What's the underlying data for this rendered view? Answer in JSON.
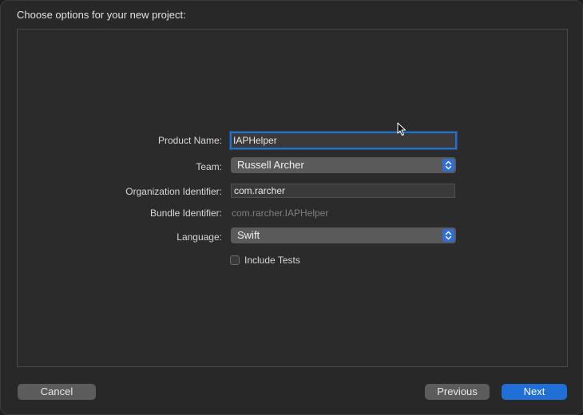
{
  "sheet": {
    "title": "Choose options for your new project:"
  },
  "form": {
    "product_name": {
      "label": "Product Name:",
      "value": "IAPHelper"
    },
    "team": {
      "label": "Team:",
      "value": "Russell Archer"
    },
    "organization_identifier": {
      "label": "Organization Identifier:",
      "value": "com.rarcher"
    },
    "bundle_identifier": {
      "label": "Bundle Identifier:",
      "value": "com.rarcher.IAPHelper"
    },
    "language": {
      "label": "Language:",
      "value": "Swift"
    },
    "include_tests": {
      "label": "Include Tests",
      "checked": false
    }
  },
  "buttons": {
    "cancel": "Cancel",
    "previous": "Previous",
    "next": "Next"
  },
  "colors": {
    "accent": "#1f6fd6",
    "focus_ring": "#2a6fbf",
    "background": "#282828"
  },
  "icons": {
    "popup_indicator": "up-down-chevron-icon",
    "pointer": "mouse-pointer-icon"
  }
}
